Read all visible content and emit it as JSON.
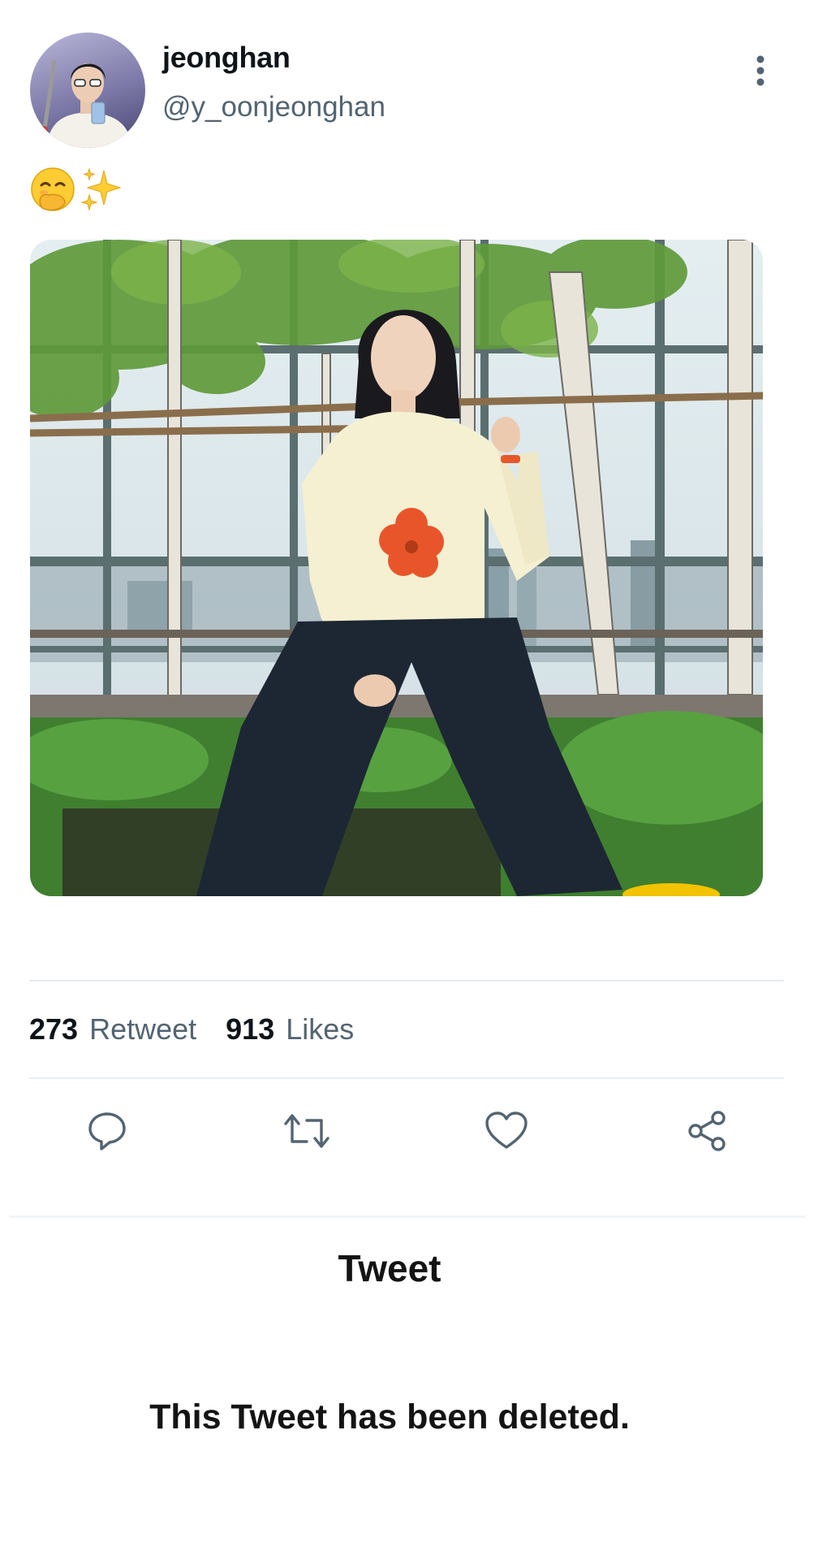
{
  "tweet": {
    "author": {
      "display_name": "jeonghan",
      "handle": "@y_oonjeonghan",
      "avatar_icon": "profile-photo"
    },
    "text_emojis": [
      "face-with-hand-over-mouth-emoji",
      "sparkles-emoji"
    ],
    "media": {
      "type": "photo",
      "alt": ""
    },
    "stats": {
      "retweets_count": "273",
      "retweets_label": "Retweet",
      "likes_count": "913",
      "likes_label": "Likes"
    },
    "actions": [
      {
        "name": "reply",
        "icon": "comment-bubble-icon"
      },
      {
        "name": "retweet",
        "icon": "retweet-arrows-icon"
      },
      {
        "name": "like",
        "icon": "heart-icon"
      },
      {
        "name": "share",
        "icon": "share-nodes-icon"
      }
    ],
    "menu_icon": "more-vertical-icon"
  },
  "deleted_section": {
    "title": "Tweet",
    "message": "This Tweet has been deleted."
  },
  "colors": {
    "text_primary": "#0f1419",
    "text_secondary": "#536471",
    "divider": "#e6ecf0",
    "icon": "#536471"
  }
}
